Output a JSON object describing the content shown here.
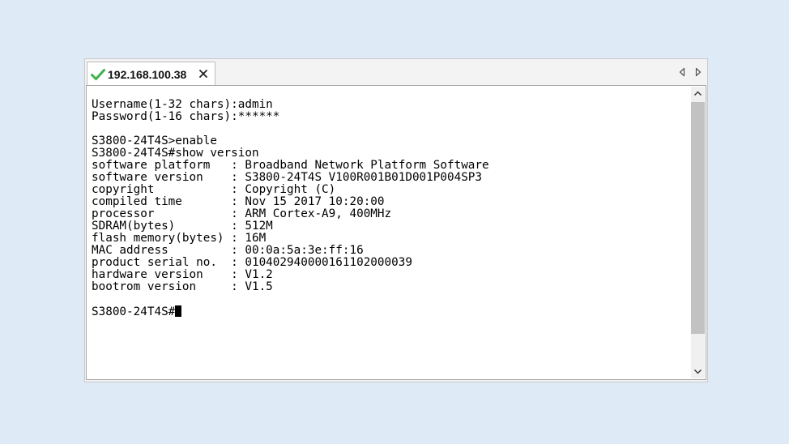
{
  "tab": {
    "title": "192.168.100.38",
    "status_icon": "check-icon",
    "close_icon": "close-icon"
  },
  "nav": {
    "left_icon": "arrow-left-icon",
    "right_icon": "arrow-right-icon"
  },
  "terminal": {
    "lines": [
      "Username(1-32 chars):admin",
      "Password(1-16 chars):******",
      "",
      "S3800-24T4S>enable",
      "S3800-24T4S#show version",
      "software platform   : Broadband Network Platform Software",
      "software version    : S3800-24T4S V100R001B01D001P004SP3",
      "copyright           : Copyright (C)",
      "compiled time       : Nov 15 2017 10:20:00",
      "processor           : ARM Cortex-A9, 400MHz",
      "SDRAM(bytes)        : 512M",
      "flash memory(bytes) : 16M",
      "MAC address         : 00:0a:5a:3e:ff:16",
      "product serial no.  : 010402940000161102000039",
      "hardware version    : V1.2",
      "bootrom version     : V1.5",
      ""
    ],
    "prompt": "S3800-24T4S#"
  },
  "colors": {
    "background": "#deeaf6",
    "check_icon": "#3bb34a",
    "scroll_thumb": "#c2c2c2"
  }
}
